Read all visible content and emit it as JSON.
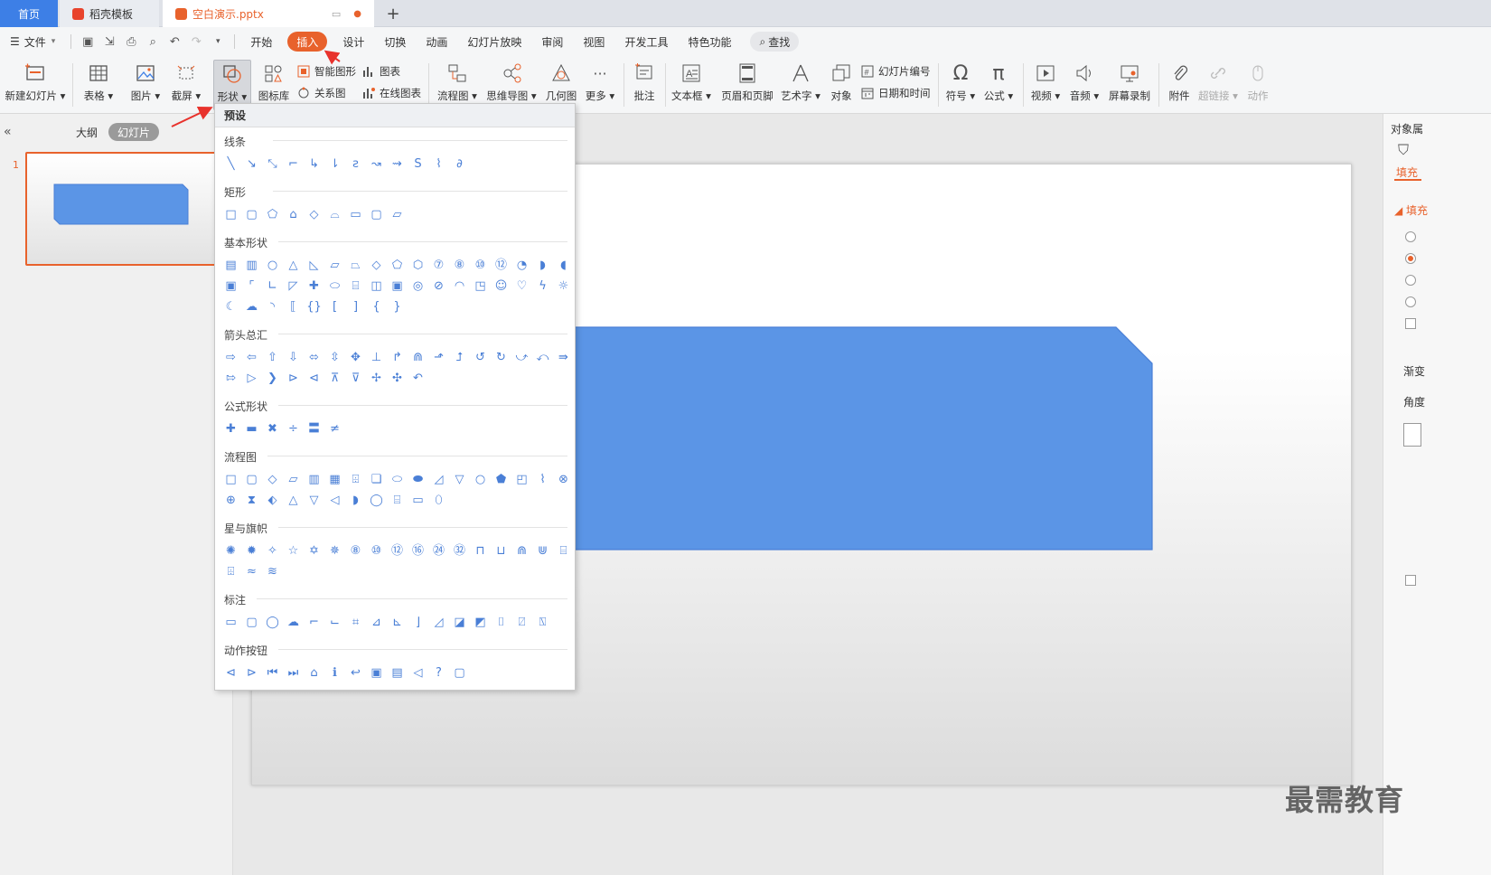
{
  "tabs": {
    "home": "首页",
    "template": "稻壳模板",
    "file": "空白演示.pptx",
    "add": "+"
  },
  "menu": {
    "file": "文件",
    "items": [
      "开始",
      "插入",
      "设计",
      "切换",
      "动画",
      "幻灯片放映",
      "审阅",
      "视图",
      "开发工具",
      "特色功能"
    ],
    "search": "查找"
  },
  "ribbon": {
    "new_slide": "新建幻灯片",
    "table": "表格",
    "picture": "图片",
    "screenshot": "截屏",
    "shape": "形状",
    "icon_lib": "图标库",
    "smart_art": "智能图形",
    "chart": "图表",
    "relation": "关系图",
    "online_chart": "在线图表",
    "flowchart": "流程图",
    "mindmap": "思维导图",
    "geometry": "几何图",
    "more": "更多",
    "comment": "批注",
    "textbox": "文本框",
    "header_footer": "页眉和页脚",
    "wordart": "艺术字",
    "object": "对象",
    "slide_number": "幻灯片编号",
    "date_time": "日期和时间",
    "symbol": "符号",
    "formula": "公式",
    "video": "视频",
    "audio": "音频",
    "screen_record": "屏幕录制",
    "attachment": "附件",
    "hyperlink": "超链接",
    "action": "动作"
  },
  "left_panel": {
    "collapse": "«",
    "outline": "大纲",
    "slides": "幻灯片",
    "slide_number": "1"
  },
  "dropdown": {
    "title": "预设",
    "categories": {
      "lines": "线条",
      "rect": "矩形",
      "basic": "基本形状",
      "arrows": "箭头总汇",
      "formula": "公式形状",
      "flow": "流程图",
      "stars": "星与旗帜",
      "callouts": "标注",
      "actions": "动作按钮"
    }
  },
  "right_panel": {
    "title": "对象属",
    "fill_tab": "填充",
    "fill_section": "填充",
    "gradient": "渐变",
    "angle": "角度"
  },
  "watermark": "最需教育",
  "colors": {
    "accent": "#e8622c",
    "shape_fill": "#5b95e6",
    "tab_home": "#3d7fe6"
  }
}
